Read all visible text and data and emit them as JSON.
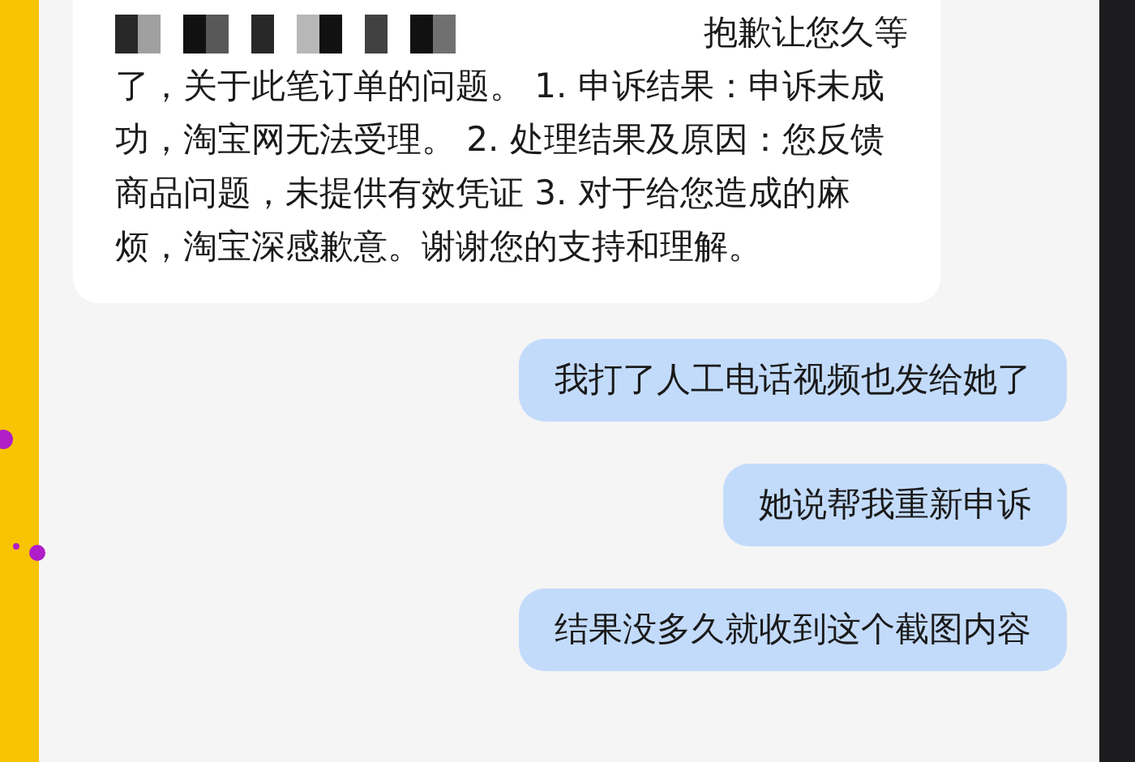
{
  "messages": [
    {
      "kind": "incoming",
      "redacted": true,
      "lead": "抱歉让您久等",
      "text": "了，关于此笔订单的问题。 1. 申诉结果：申诉未成功，淘宝网无法受理。 2. 处理结果及原因：您反馈商品问题，未提供有效凭证 3. 对于给您造成的麻烦，淘宝深感歉意。谢谢您的支持和理解。"
    },
    {
      "kind": "outgoing",
      "text": "我打了人工电话视频也发给她了"
    },
    {
      "kind": "outgoing",
      "text": "她说帮我重新申诉"
    },
    {
      "kind": "outgoing",
      "text": "结果没多久就收到这个截图内容"
    }
  ]
}
